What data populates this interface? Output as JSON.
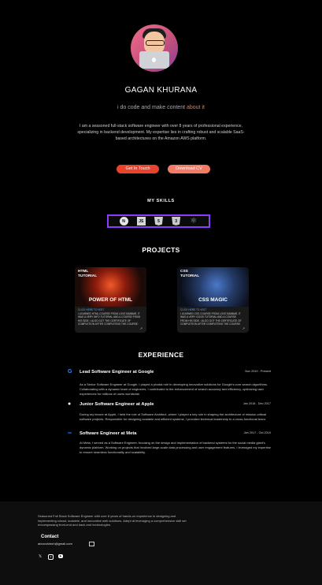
{
  "profile": {
    "name": "GAGAN KHURANA",
    "tagline_prefix": "i do code and make content ",
    "tagline_highlight": "about it",
    "bio": "I am a seasoned full-stack software engineer with over 8 years of professional experience, specializing in backend development. My expertise lies in crafting robust and scalable SaaS-based architectures on the Amazon AWS platform."
  },
  "buttons": {
    "talk": "Get In Touch",
    "cv": "Download CV"
  },
  "skills": {
    "title": "MY SKILLS",
    "icons": [
      "nextjs-icon",
      "javascript-icon",
      "html5-icon",
      "css3-icon",
      "react-icon"
    ],
    "labels": [
      "N",
      "JS",
      "5",
      "3",
      "⚛"
    ]
  },
  "projects": {
    "title": "PROJECTS",
    "items": [
      {
        "image_title": "HTML TUTORIAL",
        "image_caption": "POWER OF HTML",
        "link": "CLICK HERE TO VISIT",
        "description": "I LEARNED HTML COURSE FROM LOVE BABBAR. IT WAS A VERY INFO TUTORIAL AND A COURSE FROM HIS SIDE. I ALSO GOT THE CERTIFICATE OF COMPLETION AFTER COMPLETING THE COURSE."
      },
      {
        "image_title": "CSS TUTORIAL",
        "image_caption": "CSS MAGIC",
        "link": "CLICK HERE TO VISIT",
        "description": "I LEARNED CSS COURSE FROM LOVE BABBAR. IT WAS A VERY GOOD TUTORIAL AND A COURSE FROM HIS SIDE. I ALSO GOT THE CERTIFICATE OF COMPLETION AFTER COMPLETING THE COURSE."
      }
    ]
  },
  "experience": {
    "title": "EXPERIENCE",
    "items": [
      {
        "logo": "google-logo",
        "logo_char": "G",
        "logo_color": "#4285f4",
        "role": "Lead Software Engineer at Google",
        "date": "Nov 2019 - Present",
        "description": "As a Senior Software Engineer at Google, I played a pivotal role in developing innovative solutions for Google's core search algorithms. Collaborating with a dynamic team of engineers, I contributed to the enhancement of search accuracy and efficiency, optimizing user experiences for millions of users worldwide."
      },
      {
        "logo": "apple-logo",
        "logo_char": "●",
        "logo_color": "#ffffff",
        "role": "Junior Software Engineer at Apple",
        "date": "Jan 2018 - Dec 2017",
        "description": "During my tenure at Apple, I held the role of Software Architect, where I played a key role in shaping the architecture of mission-critical software projects. Responsible for designing scalable and efficient systems, I provided technical leadership to a cross-functional team."
      },
      {
        "logo": "meta-logo",
        "logo_char": "∞",
        "logo_color": "#1877f2",
        "role": "Software Engineer at Meta",
        "date": "Jan 2017 - Oct 2019",
        "description": "At Meta, I served as a Software Engineer, focusing on the design and implementation of backend systems for the social media giant's dynamic platform. Working on projects that involved large-scale data processing and user engagement features, I leveraged my expertise to ensure seamless functionality and scalability."
      }
    ]
  },
  "footer": {
    "text": "Seasoned Full Stack Software Engineer with over 8 years of hands-on experience in designing and implementing robust, scalable, and innovative web solutions. Adept at leveraging a comprehensive skill set encompassing front-end and back-end technologies.",
    "contact_title": "Contact",
    "email": "abcxcvbtruh@gmail.com",
    "social": [
      "x-icon",
      "instagram-icon",
      "youtube-icon"
    ]
  }
}
